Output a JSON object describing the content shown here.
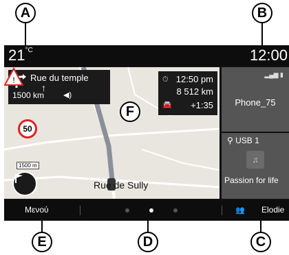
{
  "status": {
    "temperature": "21",
    "temp_unit": "°C",
    "time": "12:00"
  },
  "navigation": {
    "street": "Rue du temple",
    "distance": "1500 km",
    "eta_time": "12:50 pm",
    "remaining_distance": "8 512 km",
    "delay": "+1:35",
    "speed_limit": "50",
    "height_limit": "1500 m",
    "current_street": "Rue de Sully"
  },
  "phone": {
    "name": "Phone_75"
  },
  "media": {
    "source": "USB 1",
    "track": "Passion for life"
  },
  "bottom_bar": {
    "menu_label": "Μενού",
    "user_name": "Elodie",
    "page_count": 3,
    "active_page": 2
  },
  "callouts": {
    "a": "A",
    "b": "B",
    "c": "C",
    "d": "D",
    "e": "E",
    "f": "F"
  },
  "colors": {
    "screen_bg": "#111111",
    "widget_bg": "#555555",
    "map_bg": "#e9e6df",
    "route": "#8a8f99",
    "speed_sign_border": "#dd2222"
  },
  "icons": [
    "turn-arrow-icon",
    "straight-arrow-icon",
    "volume-icon",
    "flag-icon",
    "signal-icon",
    "battery-icon",
    "usb-icon",
    "music-note-icon",
    "users-icon",
    "car-icon",
    "clock-icon"
  ]
}
